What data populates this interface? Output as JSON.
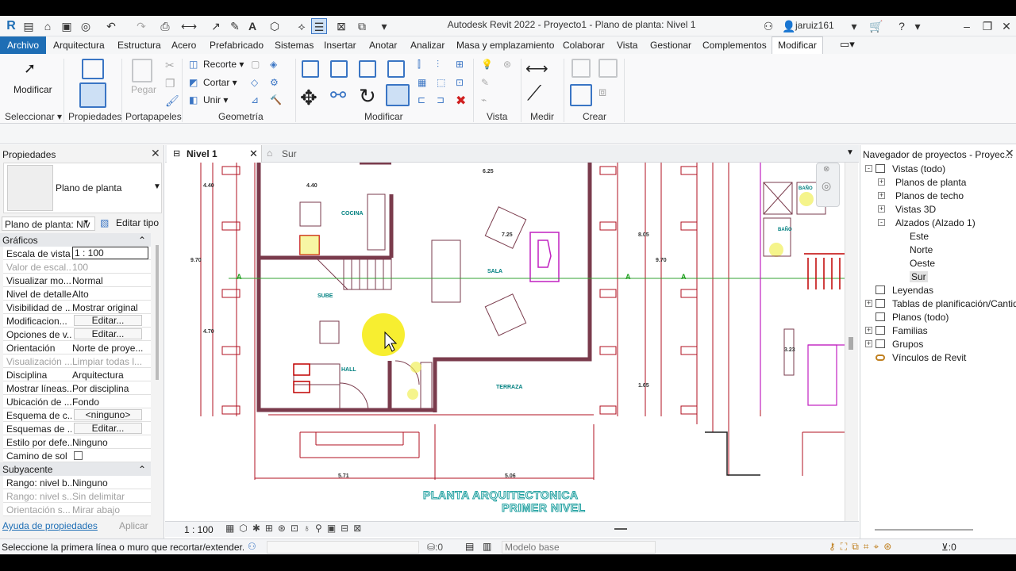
{
  "app": {
    "title": "Autodesk Revit 2022 - Proyecto1 - Plano de planta: Nivel 1",
    "user": "jaruiz161"
  },
  "menu": [
    "Archivo",
    "Arquitectura",
    "Estructura",
    "Acero",
    "Prefabricado",
    "Sistemas",
    "Insertar",
    "Anotar",
    "Analizar",
    "Masa y emplazamiento",
    "Colaborar",
    "Vista",
    "Gestionar",
    "Complementos",
    "Modificar"
  ],
  "ribbon": {
    "modificar_btn": "Modificar",
    "panels": [
      "Seleccionar",
      "Propiedades",
      "Portapapeles",
      "Geometría",
      "Modificar",
      "Vista",
      "Medir",
      "Crear"
    ],
    "pegar": "Pegar",
    "recorte": "Recorte",
    "cortar": "Cortar",
    "unir": "Unir"
  },
  "properties": {
    "title": "Propiedades",
    "type_name": "Plano de planta",
    "instance_filter": "Plano de planta: Niv",
    "edit_type": "Editar tipo",
    "sections": [
      "Gráficos",
      "Subyacente"
    ],
    "rows_graficos": [
      {
        "k": "Escala de vista",
        "v": "1 : 100"
      },
      {
        "k": "Valor de escal...",
        "v": "100",
        "dim": true
      },
      {
        "k": "Visualizar mo...",
        "v": "Normal"
      },
      {
        "k": "Nivel de detalle",
        "v": "Alto"
      },
      {
        "k": "Visibilidad de ...",
        "v": "Mostrar original"
      },
      {
        "k": "Modificacion...",
        "v": "Editar...",
        "btn": true
      },
      {
        "k": "Opciones de v...",
        "v": "Editar...",
        "btn": true
      },
      {
        "k": "Orientación",
        "v": "Norte de proye..."
      },
      {
        "k": "Visualización ...",
        "v": "Limpiar todas l...",
        "dim": true
      },
      {
        "k": "Disciplina",
        "v": "Arquitectura"
      },
      {
        "k": "Mostrar líneas...",
        "v": "Por disciplina"
      },
      {
        "k": "Ubicación de ...",
        "v": "Fondo"
      },
      {
        "k": "Esquema de c...",
        "v": "<ninguno>",
        "btn": true
      },
      {
        "k": "Esquemas de ...",
        "v": "Editar...",
        "btn": true
      },
      {
        "k": "Estilo por defe...",
        "v": "Ninguno"
      },
      {
        "k": "Camino de sol",
        "v": ""
      }
    ],
    "rows_subyacente": [
      {
        "k": "Rango: nivel b...",
        "v": "Ninguno"
      },
      {
        "k": "Rango: nivel s...",
        "v": "Sin delimitar",
        "dim": true
      },
      {
        "k": "Orientación s...",
        "v": "Mirar abajo",
        "dim": true
      }
    ],
    "help_link": "Ayuda de propiedades",
    "apply": "Aplicar"
  },
  "tabs": [
    {
      "label": "Nivel 1",
      "active": true
    },
    {
      "label": "Sur",
      "active": false
    }
  ],
  "drawing": {
    "title_line1": "PLANTA ARQUITECTONICA",
    "title_line2": "PRIMER NIVEL",
    "rooms": [
      "COCINA",
      "SALA",
      "SUBE",
      "HALL",
      "TERRAZA"
    ],
    "dims": [
      "4.40",
      "4.40",
      "6.25",
      "7.25",
      "8.05",
      "9.70",
      "9.70",
      "4.70",
      "1.65",
      "3.23",
      "5.71",
      "5.06"
    ],
    "section_marks": [
      "A",
      "A",
      "A"
    ],
    "bath_labels": [
      "BAÑO",
      "BAÑO"
    ]
  },
  "view_control": {
    "scale": "1 : 100"
  },
  "browser": {
    "title": "Navegador de proyectos - Proyec...",
    "items": [
      {
        "label": "Vistas (todo)",
        "level": 0,
        "exp": "-"
      },
      {
        "label": "Planos de planta",
        "level": 1,
        "exp": "+"
      },
      {
        "label": "Planos de techo",
        "level": 1,
        "exp": "+"
      },
      {
        "label": "Vistas 3D",
        "level": 1,
        "exp": "+"
      },
      {
        "label": "Alzados (Alzado 1)",
        "level": 1,
        "exp": "-"
      },
      {
        "label": "Este",
        "level": 2,
        "exp": ""
      },
      {
        "label": "Norte",
        "level": 2,
        "exp": ""
      },
      {
        "label": "Oeste",
        "level": 2,
        "exp": ""
      },
      {
        "label": "Sur",
        "level": 2,
        "exp": "",
        "selected": true
      },
      {
        "label": "Leyendas",
        "level": 0,
        "exp": ""
      },
      {
        "label": "Tablas de planificación/Cantidades",
        "level": 0,
        "exp": "+"
      },
      {
        "label": "Planos (todo)",
        "level": 0,
        "exp": ""
      },
      {
        "label": "Familias",
        "level": 0,
        "exp": "+"
      },
      {
        "label": "Grupos",
        "level": 0,
        "exp": "+"
      },
      {
        "label": "Vínculos de Revit",
        "level": 0,
        "exp": ""
      }
    ]
  },
  "status": {
    "message": "Seleccione la primera línea o muro que recortar/extender. Hac",
    "count": ":0",
    "model": "Modelo base",
    "filter_count": ":0"
  },
  "colors": {
    "accent": "#1e6eb5",
    "wall": "#8b4a5a",
    "dim": "#b01020",
    "room_text": "#008080"
  }
}
